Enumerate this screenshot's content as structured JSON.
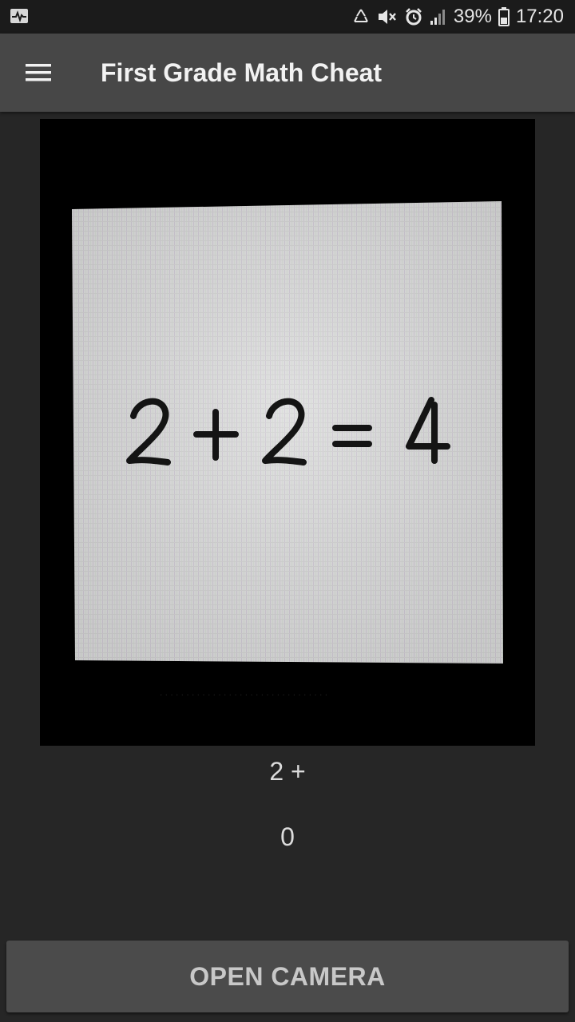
{
  "status_bar": {
    "battery_percent": "39%",
    "time": "17:20",
    "icons": [
      "activity-icon",
      "recycle-icon",
      "mute-icon",
      "alarm-icon",
      "signal-icon",
      "battery-icon"
    ]
  },
  "app_bar": {
    "title": "First Grade Math Cheat",
    "menu_icon": "hamburger-menu-icon"
  },
  "photo": {
    "equation_text": "2 + 2 = 4",
    "description_icon": "captured-photo"
  },
  "results": {
    "recognized_text": "2 +",
    "answer": "0"
  },
  "actions": {
    "open_camera_label": "OPEN CAMERA"
  },
  "colors": {
    "background": "#262626",
    "app_bar": "#474747",
    "status_bar": "#1b1b1b",
    "button": "#4b4b4b"
  }
}
